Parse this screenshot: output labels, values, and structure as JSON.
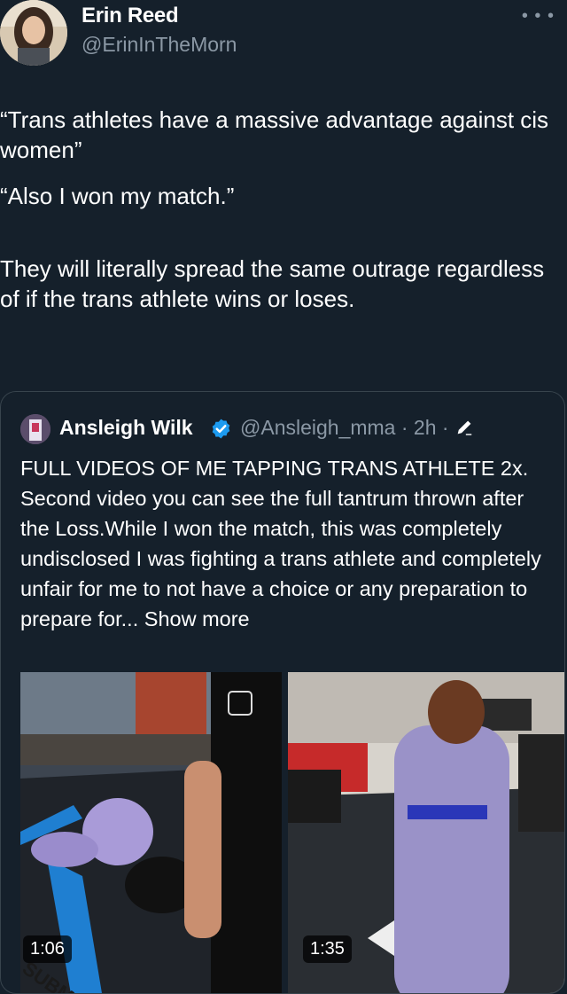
{
  "author": {
    "name": "Erin Reed",
    "handle": "@ErinInTheMorn",
    "more_icon": "more-icon"
  },
  "tweet": {
    "paragraphs": [
      "“Trans athletes have a massive advantage against cis women”",
      "“Also I won my match.”",
      "They will literally spread the same outrage regardless of if the trans athlete wins or loses."
    ]
  },
  "quoted": {
    "name": "Ansleigh Wilk",
    "meta": "@Ansleigh_mma · 2h ·",
    "text": "FULL VIDEOS  OF ME TAPPING TRANS ATHLETE 2x. Second video you can see the full tantrum thrown after the Loss.While I won the match, this was completely undisclosed I was fighting a trans athlete and completely unfair for me to not have a choice or any preparation to prepare for... Show more",
    "media": [
      {
        "duration": "1:06",
        "mat_text": "SUBMIS"
      },
      {
        "duration": "1:35"
      }
    ]
  },
  "colors": {
    "background": "#15202b",
    "secondary_text": "#8b98a5",
    "verified": "#1d9bf0",
    "border": "#38444d"
  }
}
